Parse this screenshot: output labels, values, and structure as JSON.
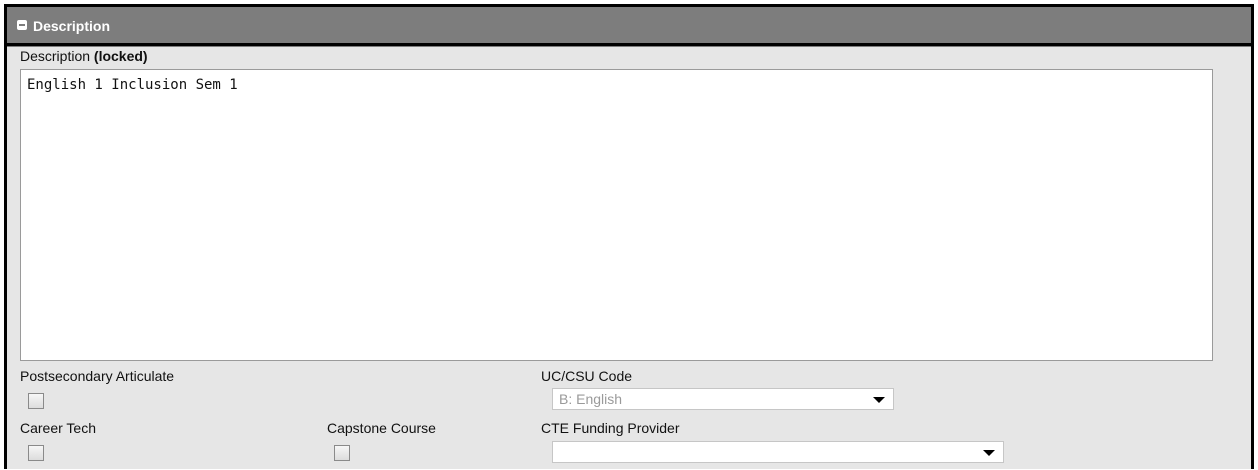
{
  "section": {
    "title": "Description",
    "icon": "collapse-icon"
  },
  "description": {
    "label": "Description",
    "locked_label": "(locked)",
    "value": "English 1 Inclusion Sem 1"
  },
  "fields": {
    "postsecondary_articulate": {
      "label": "Postsecondary Articulate",
      "checked": false
    },
    "career_tech": {
      "label": "Career Tech",
      "checked": false
    },
    "capstone_course": {
      "label": "Capstone Course",
      "checked": false
    },
    "uc_csu_code": {
      "label": "UC/CSU Code",
      "value": "B: English"
    },
    "cte_funding_provider": {
      "label": "CTE Funding Provider",
      "value": ""
    }
  }
}
